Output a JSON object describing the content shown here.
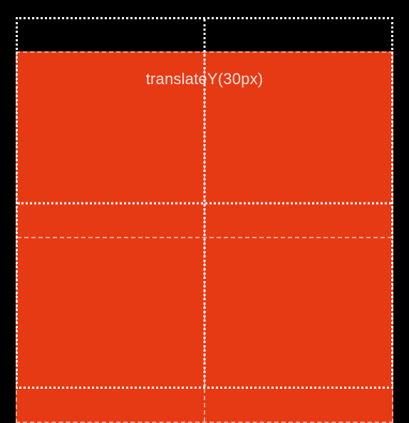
{
  "diagram": {
    "label": "translateY(30px)",
    "transform_css": "translateY(30px)",
    "colors": {
      "background": "#000000",
      "box_fill": "#e63a14",
      "grid_original": "#ffffff",
      "grid_translated": "rgba(255,255,255,0.55)"
    }
  }
}
